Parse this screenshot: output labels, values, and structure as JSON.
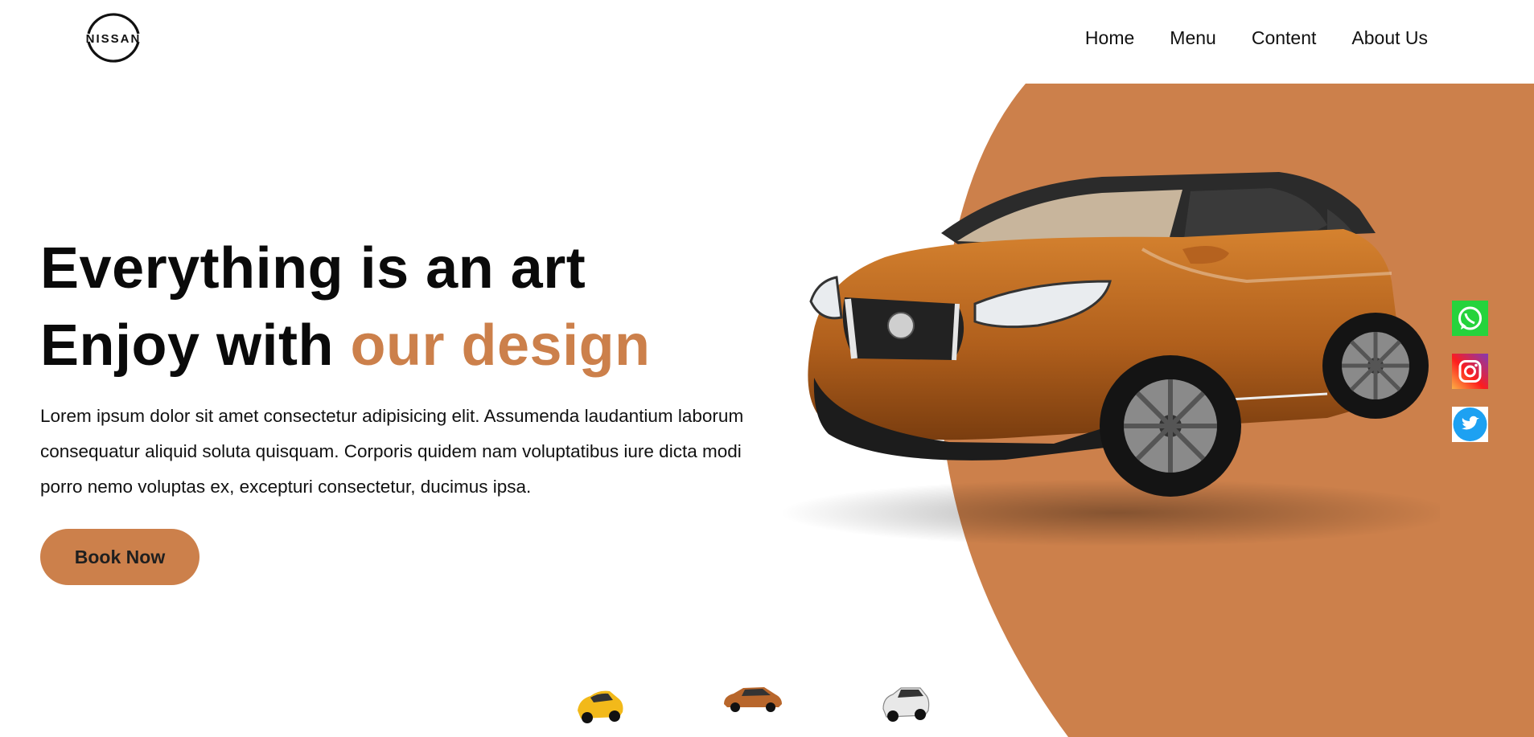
{
  "brand": {
    "logo_text": "NISSAN"
  },
  "nav": {
    "items": [
      {
        "label": "Home"
      },
      {
        "label": "Menu"
      },
      {
        "label": "Content"
      },
      {
        "label": "About Us"
      }
    ]
  },
  "hero": {
    "line1": "Everything is an art",
    "line2_prefix": "Enjoy with ",
    "line2_accent": "our design",
    "description": "Lorem ipsum dolor sit amet consectetur adipisicing elit. Assumenda laudantium laborum consequatur aliquid soluta quisquam. Corporis quidem nam voluptatibus iure dicta modi porro nemo voluptas ex, excepturi consectetur, ducimus ipsa.",
    "cta_label": "Book Now"
  },
  "social": [
    {
      "icon": "whatsapp-icon"
    },
    {
      "icon": "instagram-icon"
    },
    {
      "icon": "twitter-icon"
    }
  ],
  "thumbnails": [
    {
      "icon": "car-thumbnail-yellow",
      "color": "#f2b91a"
    },
    {
      "icon": "car-thumbnail-orange",
      "color": "#b8662b"
    },
    {
      "icon": "car-thumbnail-white",
      "color": "#e8e8e8"
    }
  ],
  "colors": {
    "accent": "#cc804b",
    "background": "#ffffff",
    "text": "#111111"
  }
}
